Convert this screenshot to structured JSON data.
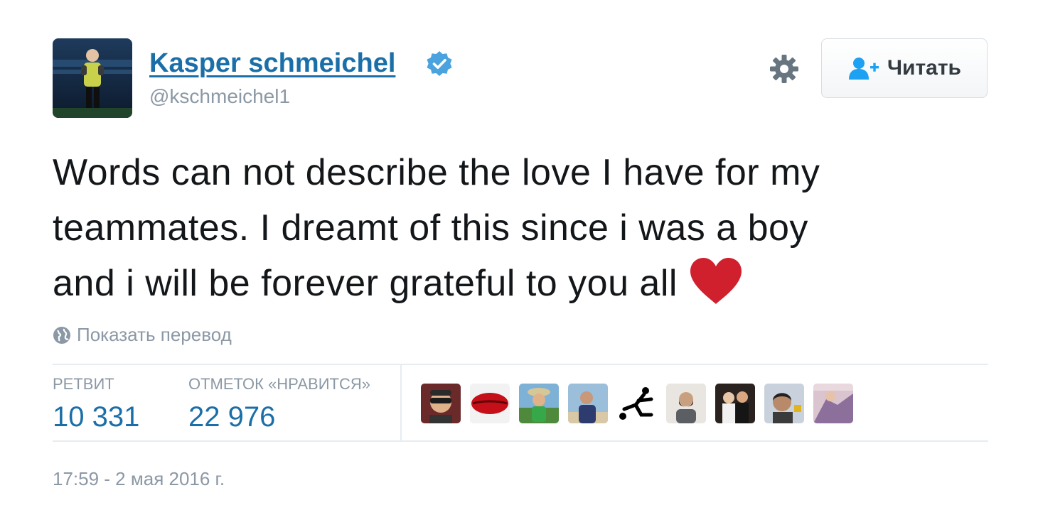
{
  "user": {
    "display_name": "Kasper schmeichel",
    "handle": "@kschmeichel1",
    "verified": true
  },
  "actions": {
    "follow_label": "Читать"
  },
  "tweet": {
    "text_lines": [
      "Words can not describe the love I have for my",
      "teammates. I dreamt of this since i was a boy",
      "and i will be forever grateful to you all"
    ],
    "emoji": "heart-icon",
    "translate_label": "Показать перевод"
  },
  "stats": {
    "retweets_label": "РЕТВИТ",
    "retweets_value": "10 331",
    "likes_label": "ОТМЕТОК «НРАВИТСЯ»",
    "likes_value": "22 976"
  },
  "likers_count_shown": 9,
  "timestamp": "17:59 - 2 мая 2016 г.",
  "colors": {
    "link": "#1b6fa8",
    "verified": "#4aa3df",
    "muted": "#8b98a5",
    "heart": "#d0202e",
    "divider": "#e6ecf0"
  }
}
